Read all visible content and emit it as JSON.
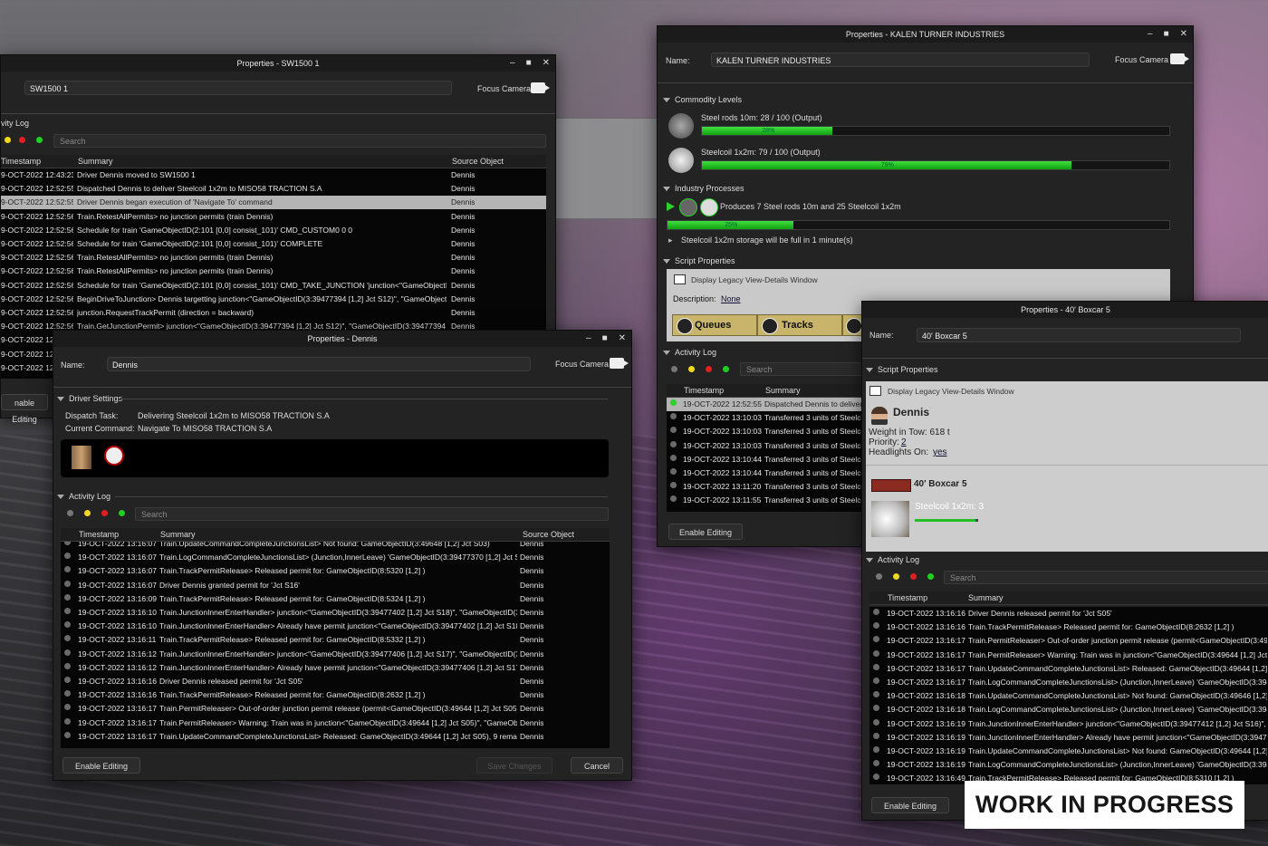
{
  "sw": {
    "title": "Properties - SW1500 1",
    "name_value": "SW1500 1",
    "focus_camera": "Focus Camera",
    "activity_log": "vity Log",
    "search_placeholder": "Search",
    "col_timestamp": "Timestamp",
    "col_summary": "Summary",
    "col_source": "Source Object",
    "enable_editing": "nable Editing",
    "rows": [
      {
        "t": "9-OCT-2022 12:43:23",
        "s": "Driver Dennis moved to SW1500 1",
        "o": "Dennis"
      },
      {
        "t": "9-OCT-2022 12:52:55",
        "s": "Dispatched Dennis to deliver Steelcoil 1x2m to MISO58 TRACTION S.A",
        "o": "Dennis"
      },
      {
        "t": "9-OCT-2022 12:52:55",
        "s": "Driver Dennis began execution of 'Navigate To' command",
        "o": "Dennis"
      },
      {
        "t": "9-OCT-2022 12:52:56",
        "s": "Train.RetestAllPermits> no junction permits (train Dennis)",
        "o": "Dennis"
      },
      {
        "t": "9-OCT-2022 12:52:56",
        "s": "Schedule for train 'GameObjectID(2:101 [0,0] consist_101)' CMD_CUSTOM0 0 0",
        "o": "Dennis"
      },
      {
        "t": "9-OCT-2022 12:52:56",
        "s": "Schedule for train 'GameObjectID(2:101 [0,0] consist_101)' COMPLETE",
        "o": "Dennis"
      },
      {
        "t": "9-OCT-2022 12:52:56",
        "s": "Train.RetestAllPermits> no junction permits (train Dennis)",
        "o": "Dennis"
      },
      {
        "t": "9-OCT-2022 12:52:56",
        "s": "Train.RetestAllPermits> no junction permits (train Dennis)",
        "o": "Dennis"
      },
      {
        "t": "9-OCT-2022 12:52:56",
        "s": "Schedule for train 'GameObjectID(2:101 [0,0] consist_101)' CMD_TAKE_JUNCTION 'junction<\"GameObjectID(3:...",
        "o": "Dennis"
      },
      {
        "t": "9-OCT-2022 12:52:56",
        "s": "BeginDriveToJunction> Dennis targetting junction<\"GameObjectID(3:39477394 [1,2] Jct S12)\", \"GameObjectID(...",
        "o": "Dennis"
      },
      {
        "t": "9-OCT-2022 12:52:56",
        "s": " junction.RequestTrackPermit (direction = backward)",
        "o": "Dennis"
      },
      {
        "t": "9-OCT-2022 12:52:56",
        "s": "Train.GetJunctionPermit> junction<\"GameObjectID(3:39477394 [1,2] Jct S12)\", \"GameObjectID(3:39477394 [1,2...",
        "o": "Dennis"
      },
      {
        "t": "9-OCT-2022 12:5",
        "s": "",
        "o": ""
      },
      {
        "t": "9-OCT-2022 12:5",
        "s": "",
        "o": ""
      },
      {
        "t": "9-OCT-2022 12:5",
        "s": "",
        "o": ""
      }
    ]
  },
  "dennis": {
    "title": "Properties - Dennis",
    "name_label": "Name:",
    "name_value": "Dennis",
    "focus_camera": "Focus Camera",
    "driver_settings": "Driver Settings",
    "dispatch_label": "Dispatch Task:",
    "dispatch_value": "Delivering Steelcoil 1x2m to MISO58 TRACTION S.A",
    "command_label": "Current Command:",
    "command_value": "Navigate To MISO58 TRACTION S.A",
    "activity_log": "Activity Log",
    "search_placeholder": "Search",
    "col_timestamp": "Timestamp",
    "col_summary": "Summary",
    "col_source": "Source Object",
    "enable_editing": "Enable Editing",
    "save_changes": "Save Changes",
    "cancel": "Cancel",
    "rows": [
      {
        "t": "19-OCT-2022 13:16:07",
        "s": "Train.UpdateCommandCompleteJunctionsList> Not found: GameObjectID(3:49648 [1,2] Jct S03)",
        "o": "Dennis"
      },
      {
        "t": "19-OCT-2022 13:16:07",
        "s": "Train.LogCommandCompleteJunctionsList> (Junction,InnerLeave) 'GameObjectID(3:39477370 [1,2] Jct S02...",
        "o": "Dennis"
      },
      {
        "t": "19-OCT-2022 13:16:07",
        "s": "Train.TrackPermitRelease> Released permit for: GameObjectID(8:5320 [1,2] )",
        "o": "Dennis"
      },
      {
        "t": "19-OCT-2022 13:16:07",
        "s": "Driver Dennis granted permit for 'Jct S16'",
        "o": "Dennis"
      },
      {
        "t": "19-OCT-2022 13:16:09",
        "s": "Train.TrackPermitRelease> Released permit for: GameObjectID(8:5324 [1,2] )",
        "o": "Dennis"
      },
      {
        "t": "19-OCT-2022 13:16:10",
        "s": "Train.JunctionInnerEnterHandler> junction<\"GameObjectID(3:39477402 [1,2] Jct S18)\", \"GameObjectID(3:3...",
        "o": "Dennis"
      },
      {
        "t": "19-OCT-2022 13:16:10",
        "s": "Train.JunctionInnerEnterHandler> Already have permit junction<\"GameObjectID(3:39477402 [1,2] Jct S18)\"...",
        "o": "Dennis"
      },
      {
        "t": "19-OCT-2022 13:16:11",
        "s": "Train.TrackPermitRelease> Released permit for: GameObjectID(8:5332 [1,2] )",
        "o": "Dennis"
      },
      {
        "t": "19-OCT-2022 13:16:12",
        "s": "Train.JunctionInnerEnterHandler> junction<\"GameObjectID(3:39477406 [1,2] Jct S17)\", \"GameObjectID(3:3...",
        "o": "Dennis"
      },
      {
        "t": "19-OCT-2022 13:16:12",
        "s": "Train.JunctionInnerEnterHandler> Already have permit junction<\"GameObjectID(3:39477406 [1,2] Jct S17)\"...",
        "o": "Dennis"
      },
      {
        "t": "19-OCT-2022 13:16:16",
        "s": "Driver Dennis released permit for 'Jct S05'",
        "o": "Dennis"
      },
      {
        "t": "19-OCT-2022 13:16:16",
        "s": "Train.TrackPermitRelease> Released permit for: GameObjectID(8:2632 [1,2] )",
        "o": "Dennis"
      },
      {
        "t": "19-OCT-2022 13:16:17",
        "s": "Train.PermitReleaser> Out-of-order junction permit release (permit<GameObjectID(3:49644 [1,2] Jct S05)\":1...",
        "o": "Dennis"
      },
      {
        "t": "19-OCT-2022 13:16:17",
        "s": "Train.PermitReleaser> Warning: Train was in junction<\"GameObjectID(3:49644 [1,2] Jct S05)\", \"GameObjec...",
        "o": "Dennis"
      },
      {
        "t": "19-OCT-2022 13:16:17",
        "s": "Train.UpdateCommandCompleteJunctionsList> Released: GameObjectID(3:49644 [1,2] Jct S05), 9 remain",
        "o": "Dennis"
      }
    ]
  },
  "kalen": {
    "title": "Properties - KALEN TURNER INDUSTRIES",
    "name_label": "Name:",
    "name_value": "KALEN TURNER INDUSTRIES",
    "focus_camera": "Focus Camera",
    "commodity_levels": "Commodity Levels",
    "steelrods_label": "Steel rods 10m:  28 / 100  (Output)",
    "steelrods_level": 28,
    "steelrods_pct": "28%",
    "steelcoil_label": "Steelcoil 1x2m:  79 / 100  (Output)",
    "steelcoil_level": 79,
    "steelcoil_pct": "79%",
    "industry_processes": "Industry Processes",
    "produces_text": "Produces 7 Steel rods 10m and 25 Steelcoil 1x2m",
    "process_level": 25,
    "process_pct": "25%",
    "storage_note": "Steelcoil 1x2m storage will be full in 1 minute(s)",
    "script_properties": "Script Properties",
    "display_legacy": "Display Legacy View-Details Window",
    "description_label": "Description:",
    "description_value": "None",
    "queues": "Queues",
    "tracks": "Tracks",
    "activity_log": "Activity Log",
    "search_placeholder": "Search",
    "col_timestamp": "Timestamp",
    "col_summary": "Summary",
    "enable_editing": "Enable Editing",
    "rows": [
      {
        "t": "19-OCT-2022 12:52:55",
        "s": "Dispatched Dennis to deliver"
      },
      {
        "t": "19-OCT-2022 13:10:03",
        "s": "Transferred 3 units of Steelcoi"
      },
      {
        "t": "19-OCT-2022 13:10:03",
        "s": "Transferred 3 units of Steelcoi"
      },
      {
        "t": "19-OCT-2022 13:10:03",
        "s": "Transferred 3 units of Steelcoi"
      },
      {
        "t": "19-OCT-2022 13:10:44",
        "s": "Transferred 3 units of Steelcoi"
      },
      {
        "t": "19-OCT-2022 13:10:44",
        "s": "Transferred 3 units of Steelcoi"
      },
      {
        "t": "19-OCT-2022 13:11:20",
        "s": "Transferred 3 units of Steelcoi"
      },
      {
        "t": "19-OCT-2022 13:11:55",
        "s": "Transferred 3 units of Steelcoi"
      }
    ]
  },
  "boxcar": {
    "title": "Properties - 40' Boxcar 5",
    "name_label": "Name:",
    "name_value": "40' Boxcar 5",
    "script_properties": "Script Properties",
    "display_legacy": "Display Legacy View-Details Window",
    "driver_name": "Dennis",
    "weight_text": "Weight in Tow: 618 t",
    "priority_label": "Priority:",
    "priority_value": "2",
    "headlights_label": "Headlights On:",
    "headlights_value": "yes",
    "car_name": "40' Boxcar 5",
    "load_text": "Steelcoil 1x2m: 3",
    "load_level": 3,
    "activity_log": "Activity Log",
    "search_placeholder": "Search",
    "col_timestamp": "Timestamp",
    "col_summary": "Summary",
    "enable_editing": "Enable Editing",
    "rows": [
      {
        "t": "19-OCT-2022 13:16:16",
        "s": "Driver Dennis released permit for 'Jct S05'"
      },
      {
        "t": "19-OCT-2022 13:16:16",
        "s": "Train.TrackPermitRelease> Released permit for: GameObjectID(8:2632 [1,2] )"
      },
      {
        "t": "19-OCT-2022 13:16:17",
        "s": "Train.PermitReleaser> Out-of-order junction permit release (permit<GameObjectID(3:49644 [1,2] Jct S05)"
      },
      {
        "t": "19-OCT-2022 13:16:17",
        "s": "Train.PermitReleaser> Warning: Train was in junction<\"GameObjectID(3:49644 [1,2] Jct S05)\""
      },
      {
        "t": "19-OCT-2022 13:16:17",
        "s": "Train.UpdateCommandCompleteJunctionsList> Released: GameObjectID(3:49644 [1,2] Jct S05"
      },
      {
        "t": "19-OCT-2022 13:16:17",
        "s": "Train.LogCommandCompleteJunctionsList> (Junction,InnerLeave) 'GameObjectID(3:394773"
      },
      {
        "t": "19-OCT-2022 13:16:18",
        "s": "Train.UpdateCommandCompleteJunctionsList> Not found: GameObjectID(3:49646 [1,2] Jct"
      },
      {
        "t": "19-OCT-2022 13:16:18",
        "s": "Train.LogCommandCompleteJunctionsList> (Junction,InnerLeave) 'GameObjectID(3:394773"
      },
      {
        "t": "19-OCT-2022 13:16:19",
        "s": "Train.JunctionInnerEnterHandler> junction<\"GameObjectID(3:39477412 [1,2] Jct S16)\", \"Gam"
      },
      {
        "t": "19-OCT-2022 13:16:19",
        "s": "Train.JunctionInnerEnterHandler> Already have permit junction<\"GameObjectID(3:3947741"
      },
      {
        "t": "19-OCT-2022 13:16:19",
        "s": "Train.UpdateCommandCompleteJunctionsList> Not found: GameObjectID(3:49644 [1,2] Jct"
      },
      {
        "t": "19-OCT-2022 13:16:19",
        "s": "Train.LogCommandCompleteJunctionsList> (Junction,InnerLeave) 'GameObjectID(3:394773"
      },
      {
        "t": "19-OCT-2022 13:16:49",
        "s": "Train.TrackPermitRelease> Released permit for: GameObjectID(8:5310 [1,2] )"
      }
    ]
  },
  "banner": "WORK IN PROGRESS",
  "colors": {
    "window_bg": "#232323",
    "log_bg": "#060606",
    "progress": "#22c022",
    "selected_row": "#b4b4b4",
    "banner_bg": "#ffffff"
  }
}
